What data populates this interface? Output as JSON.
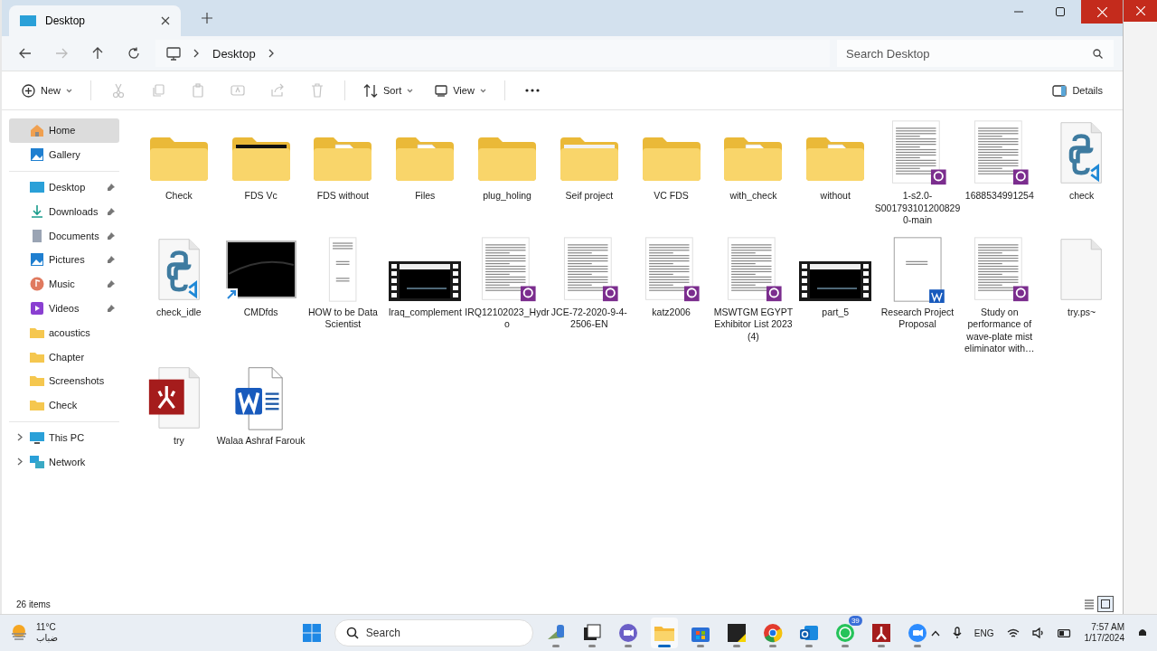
{
  "window": {
    "tab_title": "Desktop"
  },
  "address": {
    "breadcrumb": [
      "Desktop"
    ],
    "search_placeholder": "Search Desktop"
  },
  "toolbar": {
    "new_label": "New",
    "sort_label": "Sort",
    "view_label": "View",
    "details_label": "Details",
    "actions": [
      {
        "kind": "cut",
        "disabled": true
      },
      {
        "kind": "copy",
        "disabled": true
      },
      {
        "kind": "paste",
        "disabled": true
      },
      {
        "kind": "rename",
        "disabled": true
      },
      {
        "kind": "share",
        "disabled": true
      },
      {
        "kind": "delete",
        "disabled": true
      }
    ]
  },
  "sidebar": {
    "groups": [
      [
        {
          "label": "Home",
          "kind": "home",
          "selected": true,
          "pinned": false
        },
        {
          "label": "Gallery",
          "kind": "gallery",
          "selected": false,
          "pinned": false
        }
      ],
      [
        {
          "label": "Desktop",
          "kind": "desktop",
          "selected": false,
          "pinned": true
        },
        {
          "label": "Downloads",
          "kind": "downloads",
          "selected": false,
          "pinned": true
        },
        {
          "label": "Documents",
          "kind": "documents",
          "selected": false,
          "pinned": true
        },
        {
          "label": "Pictures",
          "kind": "gallery",
          "selected": false,
          "pinned": true
        },
        {
          "label": "Music",
          "kind": "music",
          "selected": false,
          "pinned": true
        },
        {
          "label": "Videos",
          "kind": "videos",
          "selected": false,
          "pinned": true
        },
        {
          "label": "acoustics",
          "kind": "folder",
          "selected": false,
          "pinned": false
        },
        {
          "label": "Chapter",
          "kind": "folder",
          "selected": false,
          "pinned": false
        },
        {
          "label": "Screenshots",
          "kind": "folder",
          "selected": false,
          "pinned": false
        },
        {
          "label": "Check",
          "kind": "folder",
          "selected": false,
          "pinned": false
        }
      ],
      [
        {
          "label": "This PC",
          "kind": "pc",
          "selected": false,
          "pinned": false,
          "expanded": false
        },
        {
          "label": "Network",
          "kind": "network",
          "selected": false,
          "pinned": false,
          "expanded": false
        }
      ]
    ]
  },
  "files": [
    {
      "name": "Check",
      "kind": "folder"
    },
    {
      "name": "FDS Vc",
      "kind": "folder_dark"
    },
    {
      "name": "FDS without",
      "kind": "folder_file"
    },
    {
      "name": "Files",
      "kind": "folder_file"
    },
    {
      "name": "plug_holing",
      "kind": "folder"
    },
    {
      "name": "Seif project",
      "kind": "folder_picture"
    },
    {
      "name": "VC FDS",
      "kind": "folder"
    },
    {
      "name": "with_check",
      "kind": "folder_file"
    },
    {
      "name": "without",
      "kind": "folder_file"
    },
    {
      "name": "1-s2.0-S0017931012008290-main",
      "kind": "pdf"
    },
    {
      "name": "1688534991254",
      "kind": "pdf"
    },
    {
      "name": "check",
      "kind": "python"
    },
    {
      "name": "check_idle",
      "kind": "python"
    },
    {
      "name": "CMDfds",
      "kind": "terminal"
    },
    {
      "name": "HOW to be Data Scientist",
      "kind": "document"
    },
    {
      "name": "Iraq_complement",
      "kind": "video"
    },
    {
      "name": "IRQ12102023_Hydro",
      "kind": "pdf"
    },
    {
      "name": "JCE-72-2020-9-4-2506-EN",
      "kind": "pdf"
    },
    {
      "name": "katz2006",
      "kind": "pdf"
    },
    {
      "name": "MSWTGM EGYPT Exhibitor List 2023 (4)",
      "kind": "pdf"
    },
    {
      "name": "part_5",
      "kind": "video"
    },
    {
      "name": "Research Project Proposal",
      "kind": "word_thumb"
    },
    {
      "name": "Study on performance of wave-plate mist eliminator with…",
      "kind": "pdf"
    },
    {
      "name": "try.ps~",
      "kind": "blank"
    },
    {
      "name": "try",
      "kind": "app"
    },
    {
      "name": "Walaa Ashraf Farouk",
      "kind": "word"
    }
  ],
  "status_bar": {
    "item_count": "26 items",
    "views": [
      {
        "kind": "details",
        "selected": false
      },
      {
        "kind": "tiles",
        "selected": true
      }
    ]
  },
  "taskbar": {
    "weather": {
      "temp": "11°C",
      "condition": "ضباب"
    },
    "search": "Search",
    "apps": [
      {
        "kind": "widgets",
        "selected": false
      },
      {
        "kind": "taskview",
        "selected": false
      },
      {
        "kind": "chat",
        "selected": false
      },
      {
        "kind": "explorer",
        "selected": true
      },
      {
        "kind": "store",
        "selected": false
      },
      {
        "kind": "notes",
        "selected": false
      },
      {
        "kind": "chrome",
        "selected": false
      },
      {
        "kind": "outlook",
        "selected": false
      },
      {
        "kind": "whatsapp",
        "selected": false,
        "badge": "39"
      },
      {
        "kind": "app",
        "selected": false
      },
      {
        "kind": "zoom",
        "selected": false
      }
    ],
    "language": "ENG",
    "time": "7:57 AM",
    "date": "1/17/2024"
  }
}
